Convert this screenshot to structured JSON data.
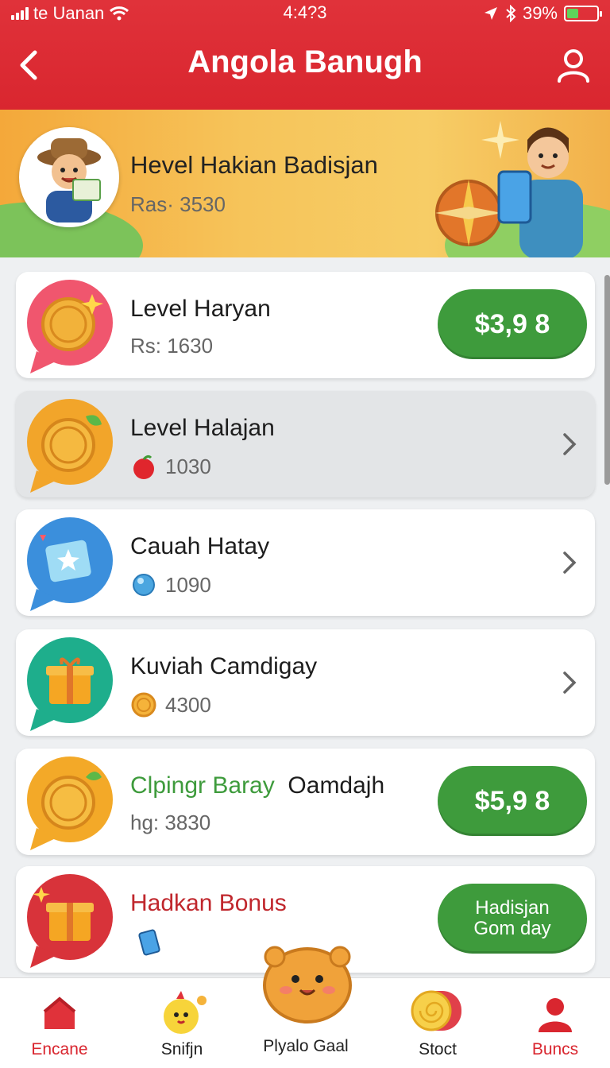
{
  "status": {
    "carrier": "te Uanan",
    "time": "4:4?3",
    "battery": "39%"
  },
  "header": {
    "title": "Angola Banugh"
  },
  "banner": {
    "title": "Hevel Hakian Badisjan",
    "subtitle": "Ras· 3530"
  },
  "items": [
    {
      "title": "Level Haryan",
      "meta": "Rs: 1630",
      "price": "$3,9 8"
    },
    {
      "title": "Level Halajan",
      "meta": "1030"
    },
    {
      "title": "Cauah Hatay",
      "meta": "1090"
    },
    {
      "title": "Kuviah Camdigay",
      "meta": "4300"
    },
    {
      "title_green": "Clpingr Baray",
      "title_black": "Oamdajh",
      "meta": "hg: 3830",
      "price": "$5,9 8"
    },
    {
      "title": "Hadkan Bonus",
      "button": "Hadisjan Gom day"
    }
  ],
  "nav": [
    {
      "label": "Encane"
    },
    {
      "label": "Snifjn"
    },
    {
      "label": "Plyalo Gaal"
    },
    {
      "label": "Stoct"
    },
    {
      "label": "Buncs"
    }
  ],
  "colors": {
    "header": "#d9262f",
    "accent_green": "#3e9b3c",
    "bonus_red": "#c0272d"
  }
}
